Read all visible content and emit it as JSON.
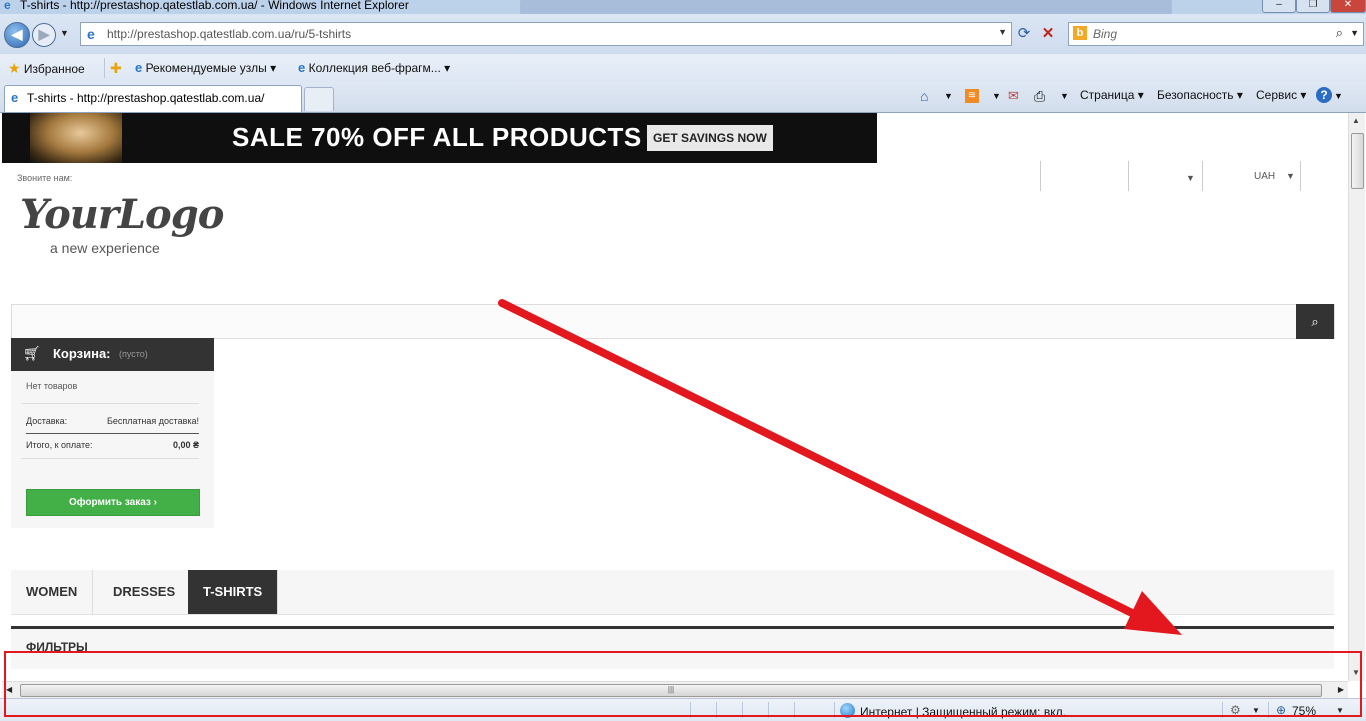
{
  "window": {
    "title": "T-shirts - http://prestashop.qatestlab.com.ua/ - Windows Internet Explorer",
    "controls": [
      "–",
      "❐",
      "✕"
    ]
  },
  "address_bar": {
    "url": "http://prestashop.qatestlab.com.ua/ru/5-tshirts",
    "search_placeholder": "Bing"
  },
  "favorites_bar": {
    "favorites_label": "Избранное",
    "items": [
      "Рекомендуемые узлы ▾",
      "Коллекция веб-фрагм... ▾"
    ]
  },
  "tabs": {
    "active_title": "T-shirts - http://prestashop.qatestlab.com.ua/"
  },
  "command_bar": {
    "page": "Страница ▾",
    "safety": "Безопасность ▾",
    "tools": "Сервис ▾"
  },
  "page": {
    "banner": {
      "text": "SALE 70% OFF ALL PRODUCTS",
      "cta": "GET SAVINGS NOW"
    },
    "call_us": "Звоните нам:",
    "currency": "UAH",
    "logo": {
      "main": "YourLogo",
      "tagline": "a new experience"
    },
    "cart": {
      "title": "Корзина:",
      "status": "(пусто)",
      "no_products": "Нет товаров",
      "shipping_label": "Доставка:",
      "shipping_value": "Бесплатная доставка!",
      "total_label": "Итого, к оплате:",
      "total_value": "0,00 ₴",
      "checkout": "Оформить заказ ›"
    },
    "menu": [
      "WOMEN",
      "DRESSES",
      "T-SHIRTS"
    ],
    "menu_active": "T-SHIRTS",
    "filters_title": "ФИЛЬТРЫ"
  },
  "status_bar": {
    "zone": "Интернет | Защищенный режим: вкл.",
    "zoom": "75%"
  },
  "colors": {
    "annotation": "#e3181e",
    "cart_button": "#43b047",
    "dark": "#333333"
  }
}
